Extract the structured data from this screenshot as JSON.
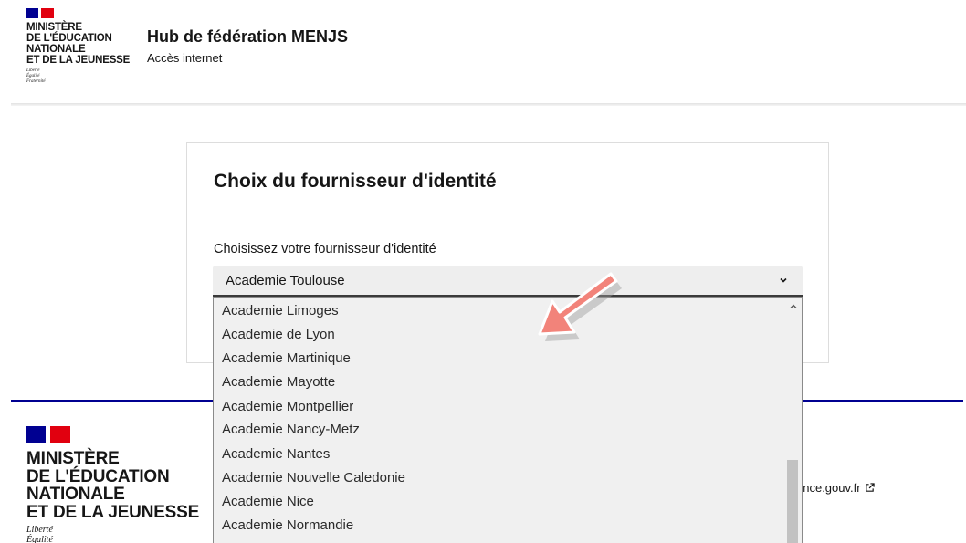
{
  "header": {
    "ministry_lines": [
      "MINISTÈRE",
      "DE L'ÉDUCATION",
      "NATIONALE",
      "ET DE LA JEUNESSE"
    ],
    "motto_lines": [
      "Liberté",
      "Égalité",
      "Fraternité"
    ],
    "title": "Hub de fédération MENJS",
    "subtitle": "Accès internet"
  },
  "card": {
    "title": "Choix du fournisseur d'identité",
    "select_label": "Choisissez votre fournisseur d'identité",
    "selected_value": "Academie Toulouse"
  },
  "dropdown": {
    "options": [
      "Academie Limoges",
      "Academie de Lyon",
      "Academie Martinique",
      "Academie Mayotte",
      "Academie Montpellier",
      "Academie Nancy-Metz",
      "Academie Nantes",
      "Academie Nouvelle Caledonie",
      "Academie Nice",
      "Academie Normandie"
    ]
  },
  "footer": {
    "ministry_lines": [
      "MINISTÈRE",
      "DE L'ÉDUCATION",
      "NATIONALE",
      "ET DE LA JEUNESSE"
    ],
    "motto_lines": [
      "Liberté",
      "Égalité"
    ],
    "link_text": "ance.gouv.fr"
  },
  "colors": {
    "marianne_blue": "#000091",
    "marianne_red": "#e1000f",
    "annotation_arrow": "#f2837a"
  },
  "icons": [
    "chevron-down-icon",
    "chevron-up-icon",
    "external-link-icon",
    "annotation-arrow-icon"
  ]
}
